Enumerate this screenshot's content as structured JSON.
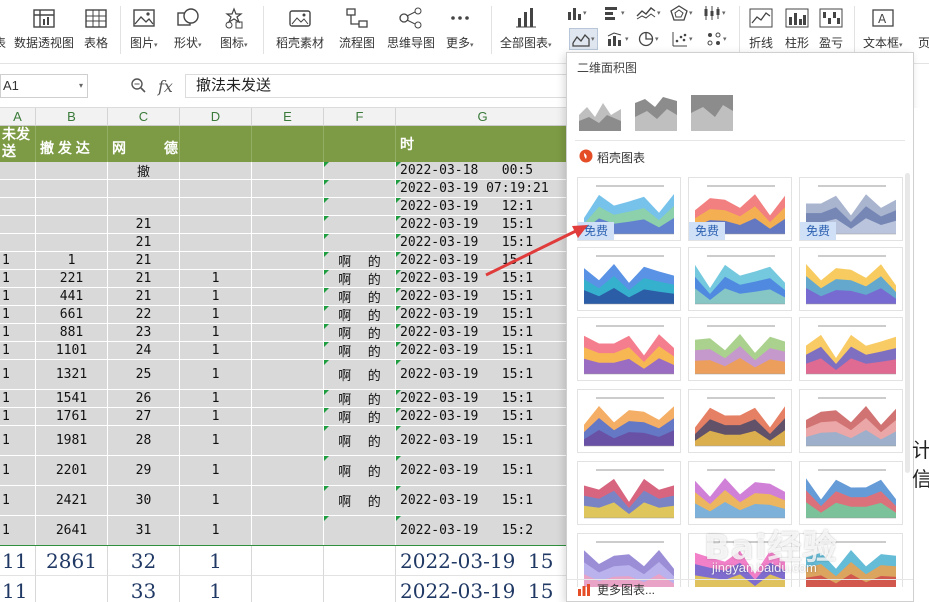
{
  "ribbon": {
    "buttons": [
      {
        "label": "表",
        "icon": "table-icon"
      },
      {
        "label": "数据透视图",
        "icon": "pivot-chart-icon"
      },
      {
        "label": "表格",
        "icon": "table-icon"
      },
      {
        "label": "图片",
        "icon": "picture-icon"
      },
      {
        "label": "形状",
        "icon": "shape-icon"
      },
      {
        "label": "图标",
        "icon": "icons-icon"
      },
      {
        "label": "稻壳素材",
        "icon": "material-icon"
      },
      {
        "label": "流程图",
        "icon": "flowchart-icon"
      },
      {
        "label": "思维导图",
        "icon": "mindmap-icon"
      },
      {
        "label": "更多",
        "icon": "more-icon"
      },
      {
        "label": "全部图表",
        "icon": "all-charts-icon"
      },
      {
        "label": "折线",
        "icon": "sparkline-line-icon"
      },
      {
        "label": "柱形",
        "icon": "sparkline-column-icon"
      },
      {
        "label": "盈亏",
        "icon": "sparkline-winloss-icon"
      },
      {
        "label": "文本框",
        "icon": "textbox-icon"
      },
      {
        "label": "页",
        "icon": "page-icon"
      }
    ]
  },
  "formula": {
    "name_box": "A1",
    "content": "撤法未发送"
  },
  "columns": [
    "A",
    "B",
    "C",
    "D",
    "E",
    "F",
    "G"
  ],
  "sheet": {
    "header": {
      "a": "未发\n送",
      "b": "撤 发 达",
      "c": "网",
      "d": "德",
      "g": "时"
    },
    "rows": [
      {
        "a": "",
        "b": "",
        "c": "撤",
        "d": "",
        "f": "",
        "g": "2022-03-18   00:5"
      },
      {
        "a": "",
        "b": "",
        "c": "",
        "d": "",
        "f": "",
        "g": "2022-03-19 07:19:21"
      },
      {
        "a": "",
        "b": "",
        "c": "",
        "d": "",
        "f": "",
        "g": "2022-03-19   12:1"
      },
      {
        "a": "",
        "b": "",
        "c": "21",
        "d": "",
        "f": "",
        "g": "2022-03-19   15:1"
      },
      {
        "a": "",
        "b": "",
        "c": "21",
        "d": "",
        "f": "",
        "g": "2022-03-19   15:1"
      },
      {
        "a": "1",
        "b": "1",
        "c": "21",
        "d": "",
        "f": "啊    的",
        "g": "2022-03-19   15:1"
      },
      {
        "a": "1",
        "b": "221",
        "c": "21",
        "d": "1",
        "f": "啊    的",
        "g": "2022-03-19   15:1"
      },
      {
        "a": "1",
        "b": "441",
        "c": "21",
        "d": "1",
        "f": "啊    的",
        "g": "2022-03-19   15:1"
      },
      {
        "a": "1",
        "b": "661",
        "c": "22",
        "d": "1",
        "f": "啊    的",
        "g": "2022-03-19   15:1"
      },
      {
        "a": "1",
        "b": "881",
        "c": "23",
        "d": "1",
        "f": "啊    的",
        "g": "2022-03-19   15:1"
      },
      {
        "a": "1",
        "b": "1101",
        "c": "24",
        "d": "1",
        "f": "啊    的",
        "g": "2022-03-19   15:1"
      },
      {
        "a": "1",
        "b": "1321",
        "c": "25",
        "d": "1",
        "f": "啊    的",
        "g": "2022-03-19   15:1"
      },
      {
        "a": "1",
        "b": "1541",
        "c": "26",
        "d": "1",
        "f": "啊    的",
        "g": "2022-03-19   15:1"
      },
      {
        "a": "1",
        "b": "1761",
        "c": "27",
        "d": "1",
        "f": "啊    的",
        "g": "2022-03-19   15:1"
      },
      {
        "a": "1",
        "b": "1981",
        "c": "28",
        "d": "1",
        "f": "啊    的",
        "g": "2022-03-19   15:1"
      },
      {
        "a": "1",
        "b": "2201",
        "c": "29",
        "d": "1",
        "f": "啊    的",
        "g": "2022-03-19   15:1"
      },
      {
        "a": "1",
        "b": "2421",
        "c": "30",
        "d": "1",
        "f": "啊    的",
        "g": "2022-03-19   15:1"
      },
      {
        "a": "1",
        "b": "2641",
        "c": "31",
        "d": "1",
        "f": "",
        "g": "2022-03-19   15:2"
      },
      {
        "a": "11",
        "b": "2861",
        "c": "32",
        "d": "1",
        "f": "",
        "g": "2022-03-19  15"
      },
      {
        "a": "11",
        "b": "",
        "c": "33",
        "d": "1",
        "f": "",
        "g": "2022-03-19  15"
      }
    ]
  },
  "chart_panel": {
    "section_title": "二维面积图",
    "docer_title": "稻壳图表",
    "free_badge": "免费",
    "more_link": "更多图表..."
  },
  "watermark": {
    "main": "Bai经验",
    "sub": "jingyan.baidu.com"
  },
  "partial_text": "计信",
  "colors": {
    "header_green": "#7d9b44",
    "cell_gray": "#d9d9d9",
    "accent_blue": "#cfe0f7",
    "arrow_red": "#e03c3c"
  }
}
